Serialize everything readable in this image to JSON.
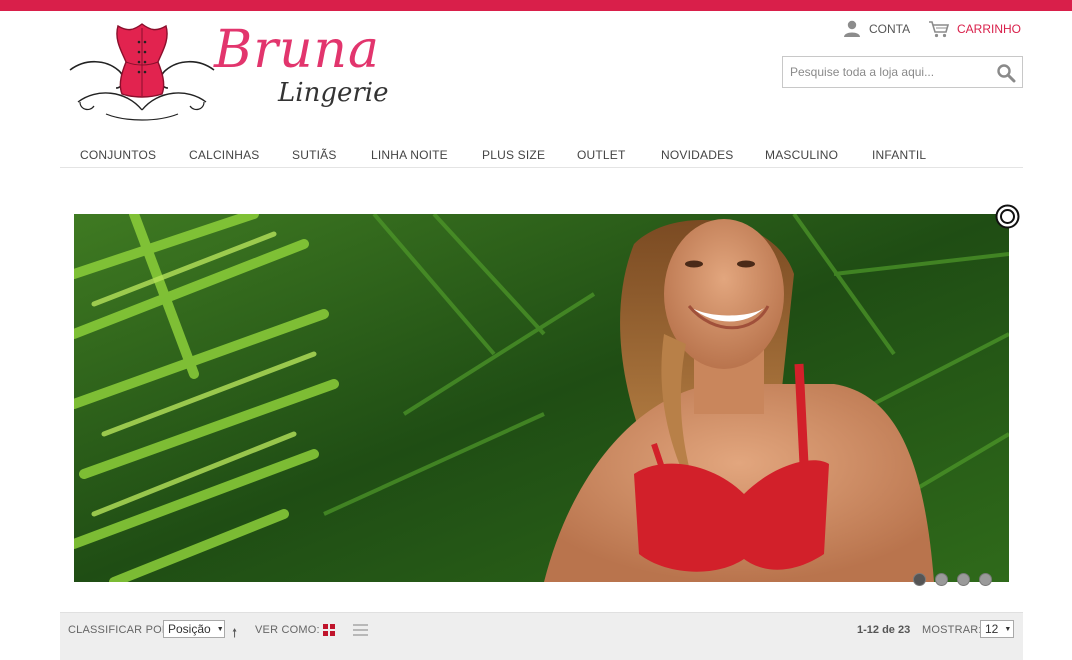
{
  "brand": {
    "name": "Bruna",
    "tagline": "Lingerie",
    "accent_color": "#d91f4a"
  },
  "header": {
    "account_label": "CONTA",
    "account_icon": "user-icon",
    "cart_label": "CARRINHO",
    "cart_icon": "cart-icon"
  },
  "search": {
    "value": "",
    "placeholder": "Pesquise toda a loja aqui...",
    "icon": "search-icon"
  },
  "nav": {
    "items": [
      {
        "label": "CONJUNTOS"
      },
      {
        "label": "CALCINHAS"
      },
      {
        "label": "SUTIÃS"
      },
      {
        "label": "LINHA NOITE"
      },
      {
        "label": "PLUS SIZE"
      },
      {
        "label": "OUTLET"
      },
      {
        "label": "NOVIDADES"
      },
      {
        "label": "MASCULINO"
      },
      {
        "label": "INFANTIL"
      }
    ]
  },
  "slider": {
    "slide_count": 4,
    "active_slide": 1,
    "pause_icon": "pause-icon"
  },
  "toolbar": {
    "sort_label": "CLASSIFICAR POR:",
    "sort_value": "Posição",
    "view_label": "VER COMO:",
    "view_mode": "grid",
    "count": "1-12 de 23",
    "show_label": "MOSTRAR:",
    "show_value": "12"
  }
}
